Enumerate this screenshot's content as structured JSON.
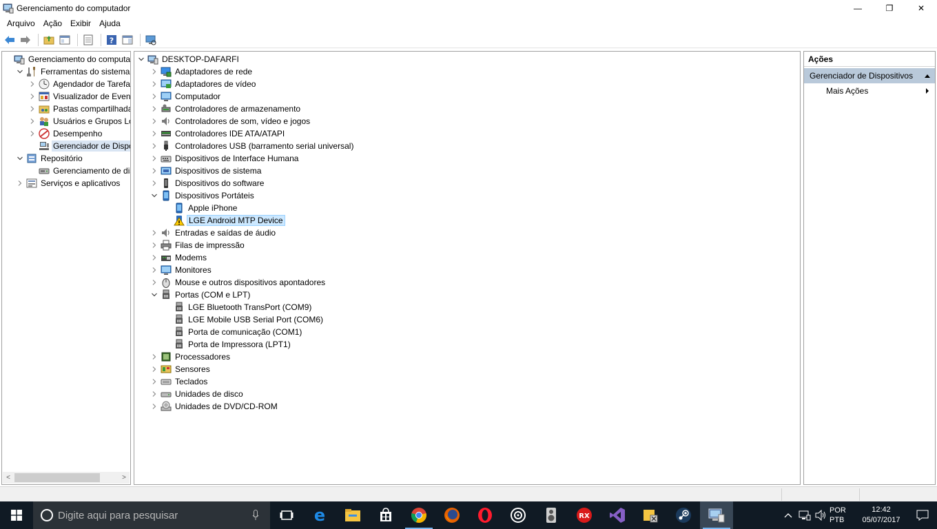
{
  "window": {
    "title": "Gerenciamento do computador",
    "minimize": "—",
    "maximize": "❐",
    "close": "✕"
  },
  "menu": [
    "Arquivo",
    "Ação",
    "Exibir",
    "Ajuda"
  ],
  "left_tree": [
    {
      "label": "Gerenciamento do computado",
      "icon": "computer-management-icon",
      "expander": "",
      "depth": 0
    },
    {
      "label": "Ferramentas do sistema",
      "icon": "tools-icon",
      "expander": "v",
      "depth": 1
    },
    {
      "label": "Agendador de Tarefas",
      "icon": "clock-icon",
      "expander": ">",
      "depth": 2
    },
    {
      "label": "Visualizador de Eventos",
      "icon": "event-viewer-icon",
      "expander": ">",
      "depth": 2
    },
    {
      "label": "Pastas compartilhadas",
      "icon": "shared-folder-icon",
      "expander": ">",
      "depth": 2
    },
    {
      "label": "Usuários e Grupos Loca",
      "icon": "users-icon",
      "expander": ">",
      "depth": 2
    },
    {
      "label": "Desempenho",
      "icon": "performance-icon",
      "expander": ">",
      "depth": 2
    },
    {
      "label": "Gerenciador de Disposit",
      "icon": "device-manager-icon",
      "expander": "",
      "depth": 2,
      "selected": true
    },
    {
      "label": "Repositório",
      "icon": "storage-icon",
      "expander": "v",
      "depth": 1
    },
    {
      "label": "Gerenciamento de disco",
      "icon": "disk-management-icon",
      "expander": "",
      "depth": 2
    },
    {
      "label": "Serviços e aplicativos",
      "icon": "services-icon",
      "expander": ">",
      "depth": 1
    }
  ],
  "device_tree": [
    {
      "label": "DESKTOP-DAFARFI",
      "icon": "computer-root-icon",
      "expander": "v",
      "depth": 0
    },
    {
      "label": "Adaptadores de rede",
      "icon": "network-adapter-icon",
      "expander": ">",
      "depth": 1
    },
    {
      "label": "Adaptadores de vídeo",
      "icon": "display-adapter-icon",
      "expander": ">",
      "depth": 1
    },
    {
      "label": "Computador",
      "icon": "computer-icon",
      "expander": ">",
      "depth": 1
    },
    {
      "label": "Controladores de armazenamento",
      "icon": "storage-controller-icon",
      "expander": ">",
      "depth": 1
    },
    {
      "label": "Controladores de som, vídeo e jogos",
      "icon": "sound-icon",
      "expander": ">",
      "depth": 1
    },
    {
      "label": "Controladores IDE ATA/ATAPI",
      "icon": "ide-icon",
      "expander": ">",
      "depth": 1
    },
    {
      "label": "Controladores USB (barramento serial universal)",
      "icon": "usb-icon",
      "expander": ">",
      "depth": 1
    },
    {
      "label": "Dispositivos de Interface Humana",
      "icon": "hid-icon",
      "expander": ">",
      "depth": 1
    },
    {
      "label": "Dispositivos de sistema",
      "icon": "system-devices-icon",
      "expander": ">",
      "depth": 1
    },
    {
      "label": "Dispositivos do software",
      "icon": "software-device-icon",
      "expander": ">",
      "depth": 1
    },
    {
      "label": "Dispositivos Portáteis",
      "icon": "portable-device-icon",
      "expander": "v",
      "depth": 1
    },
    {
      "label": "Apple iPhone",
      "icon": "portable-device-icon",
      "expander": "",
      "depth": 2
    },
    {
      "label": "LGE Android MTP Device",
      "icon": "warning-icon",
      "expander": "",
      "depth": 2,
      "selected": true
    },
    {
      "label": "Entradas e saídas de áudio",
      "icon": "audio-io-icon",
      "expander": ">",
      "depth": 1
    },
    {
      "label": "Filas de impressão",
      "icon": "printer-icon",
      "expander": ">",
      "depth": 1
    },
    {
      "label": "Modems",
      "icon": "modem-icon",
      "expander": ">",
      "depth": 1
    },
    {
      "label": "Monitores",
      "icon": "monitor-icon",
      "expander": ">",
      "depth": 1
    },
    {
      "label": "Mouse e outros dispositivos apontadores",
      "icon": "mouse-icon",
      "expander": ">",
      "depth": 1
    },
    {
      "label": "Portas (COM e LPT)",
      "icon": "port-icon",
      "expander": "v",
      "depth": 1
    },
    {
      "label": "LGE Bluetooth TransPort (COM9)",
      "icon": "port-icon",
      "expander": "",
      "depth": 2
    },
    {
      "label": "LGE Mobile USB Serial Port (COM6)",
      "icon": "port-icon",
      "expander": "",
      "depth": 2
    },
    {
      "label": "Porta de comunicação (COM1)",
      "icon": "port-icon",
      "expander": "",
      "depth": 2
    },
    {
      "label": "Porta de Impressora (LPT1)",
      "icon": "port-icon",
      "expander": "",
      "depth": 2
    },
    {
      "label": "Processadores",
      "icon": "processor-icon",
      "expander": ">",
      "depth": 1
    },
    {
      "label": "Sensores",
      "icon": "sensor-icon",
      "expander": ">",
      "depth": 1
    },
    {
      "label": "Teclados",
      "icon": "keyboard-icon",
      "expander": ">",
      "depth": 1
    },
    {
      "label": "Unidades de disco",
      "icon": "disk-drive-icon",
      "expander": ">",
      "depth": 1
    },
    {
      "label": "Unidades de DVD/CD-ROM",
      "icon": "dvd-icon",
      "expander": ">",
      "depth": 1
    }
  ],
  "actions": {
    "header": "Ações",
    "section": "Gerenciador de Dispositivos",
    "more": "Mais Ações"
  },
  "taskbar": {
    "search_placeholder": "Digite aqui para pesquisar",
    "apps": [
      "task-view-icon",
      "edge-icon",
      "file-explorer-icon",
      "store-icon",
      "chrome-icon",
      "firefox-icon",
      "opera-icon",
      "groove-icon",
      "speaker-app-icon",
      "rx-icon",
      "visual-studio-icon",
      "tools-app-icon",
      "steam-icon",
      "computer-management-taskbar-icon"
    ],
    "lang_line1": "POR",
    "lang_line2": "PTB",
    "time": "12:42",
    "date": "05/07/2017"
  },
  "colors": {
    "taskbar_bg": "#101a24",
    "selection": "#cce8ff",
    "action_section": "#b9c9da"
  }
}
